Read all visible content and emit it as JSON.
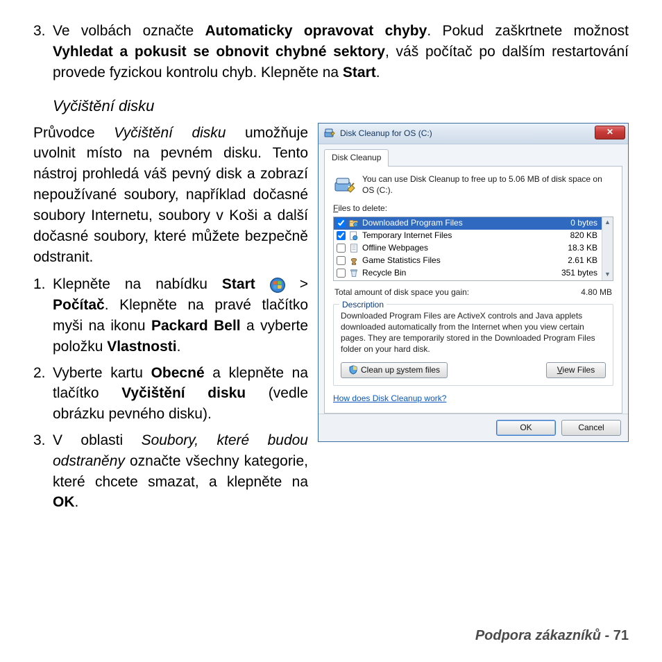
{
  "doc": {
    "item3_top": {
      "num": "3.",
      "t1": "Ve volbách označte ",
      "b1": "Automaticky opravovat chyby",
      "t2": ". Pokud zaškrtnete možnost ",
      "b2": "Vyhledat a pokusit se obnovit chybné sektory",
      "t3": ", váš počítač po dalším restartování provede fyzickou kontrolu chyb. Klepněte na ",
      "b3": "Start",
      "t4": "."
    },
    "subhead": "Vyčištění disku",
    "para": {
      "t1": "Průvodce ",
      "i1": "Vyčištění disku",
      "t2": " umožňuje uvolnit místo na pevném disku. Tento nástroj prohledá váš pevný disk a zobrazí nepoužívané soubory, například dočasné soubory Internetu, soubory v Koši a další dočasné soubory, které můžete bezpečně odstranit."
    },
    "step1": {
      "num": "1.",
      "t1": "Klepněte na nabídku ",
      "b1": "Start",
      "t2": " > ",
      "b2": "Počítač",
      "t3": ". Klepněte na pravé tlačítko myši na ikonu ",
      "b3": "Packard Bell",
      "t4": " a vyberte položku ",
      "b4": "Vlastnosti",
      "t5": "."
    },
    "step2": {
      "num": "2.",
      "t1": "Vyberte kartu ",
      "b1": "Obecné",
      "t2": " a klepněte na tlačítko ",
      "b2": "Vyčištění disku",
      "t3": " (vedle obrázku pevného disku)."
    },
    "step3": {
      "num": "3.",
      "t1": "V oblasti ",
      "i1": "Soubory, které budou odstraněny",
      "t2": " označte všechny kategorie, které chcete smazat, a klepněte na ",
      "b1": "OK",
      "t3": "."
    },
    "footer_label": "Podpora zákazníků -",
    "footer_page": "71"
  },
  "dlg": {
    "title": "Disk Cleanup for OS (C:)",
    "tab": "Disk Cleanup",
    "intro": "You can use Disk Cleanup to free up to 5.06 MB of disk space on OS (C:).",
    "files_label": "Files to delete:",
    "files": [
      {
        "name": "Downloaded Program Files",
        "size": "0 bytes",
        "checked": true,
        "selected": true,
        "icon": "folder-globe"
      },
      {
        "name": "Temporary Internet Files",
        "size": "820 KB",
        "checked": true,
        "selected": false,
        "icon": "page-globe"
      },
      {
        "name": "Offline Webpages",
        "size": "18.3 KB",
        "checked": false,
        "selected": false,
        "icon": "page"
      },
      {
        "name": "Game Statistics Files",
        "size": "2.61 KB",
        "checked": false,
        "selected": false,
        "icon": "chess"
      },
      {
        "name": "Recycle Bin",
        "size": "351 bytes",
        "checked": false,
        "selected": false,
        "icon": "bin"
      }
    ],
    "gain_label": "Total amount of disk space you gain:",
    "gain_value": "4.80 MB",
    "desc_legend": "Description",
    "desc_text": "Downloaded Program Files are ActiveX controls and Java applets downloaded automatically from the Internet when you view certain pages. They are temporarily stored in the Downloaded Program Files folder on your hard disk.",
    "btn_cleanup": "Clean up system files",
    "btn_view": "View Files",
    "link": "How does Disk Cleanup work?",
    "btn_ok": "OK",
    "btn_cancel": "Cancel"
  }
}
